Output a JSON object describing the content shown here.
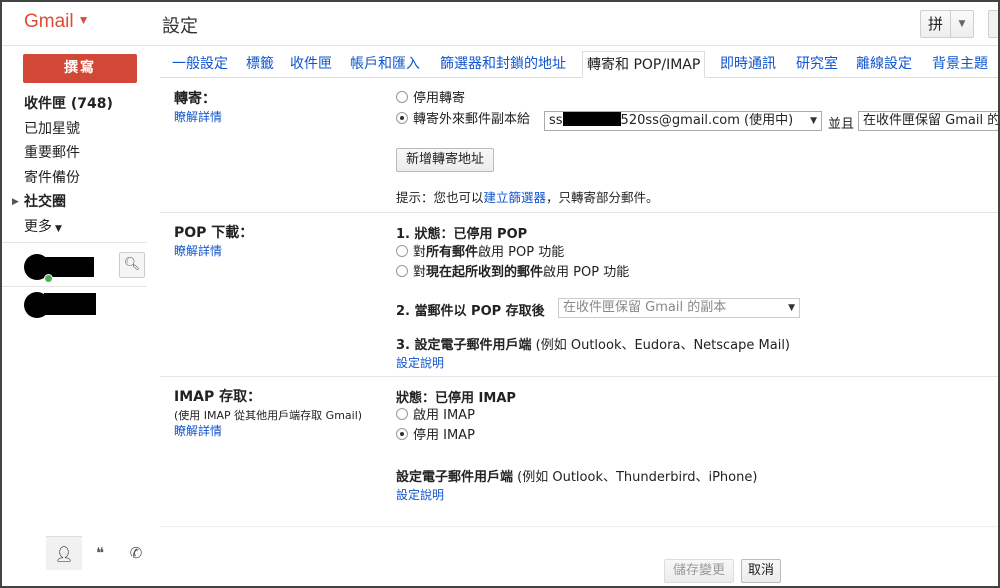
{
  "header": {
    "logo": "Gmail",
    "page_title": "設定",
    "ime_label": "拼"
  },
  "sidebar": {
    "compose": "撰寫",
    "nav": [
      {
        "label": "收件匣 (748)"
      },
      {
        "label": "已加星號"
      },
      {
        "label": "重要郵件"
      },
      {
        "label": "寄件備份"
      },
      {
        "label": "社交圈"
      },
      {
        "label": "更多"
      }
    ]
  },
  "tabs": [
    {
      "label": "一般設定"
    },
    {
      "label": "標籤"
    },
    {
      "label": "收件匣"
    },
    {
      "label": "帳戶和匯入"
    },
    {
      "label": "篩選器和封鎖的地址"
    },
    {
      "label": "轉寄和 POP/IMAP"
    },
    {
      "label": "即時通訊"
    },
    {
      "label": "研究室"
    },
    {
      "label": "離線設定"
    },
    {
      "label": "背景主題"
    }
  ],
  "forwarding": {
    "label": "轉寄：",
    "learn_more": "瞭解詳情",
    "disable": "停用轉寄",
    "forward_to": "轉寄外來郵件副本給",
    "address_prefix": "ss",
    "address_suffix": "520ss@gmail.com (使用中)",
    "and": "並且",
    "keep_option": "在收件匣保留 Gmail 的",
    "add_address": "新增轉寄地址",
    "tip_prefix": "提示：您也可以",
    "tip_link": "建立篩選器",
    "tip_suffix": "，只轉寄部分郵件。"
  },
  "pop": {
    "label": "POP 下載：",
    "learn_more": "瞭解詳情",
    "status_prefix": "1. 狀態：",
    "status_value": "已停用 POP",
    "opt_all_prefix": "對",
    "opt_all_bold": "所有郵件",
    "opt_all_suffix": "啟用 POP 功能",
    "opt_now_prefix": "對",
    "opt_now_bold": "現在起所收到的郵件",
    "opt_now_suffix": "啟用 POP 功能",
    "when_accessed": "2. 當郵件以 POP 存取後",
    "when_select": "在收件匣保留 Gmail 的副本",
    "configure_prefix": "3. 設定電子郵件用戶端",
    "configure_suffix": " (例如 Outlook、Eudora、Netscape Mail)",
    "config_link": "設定說明"
  },
  "imap": {
    "label": "IMAP 存取：",
    "sub": "(使用 IMAP 從其他用戶端存取 Gmail)",
    "learn_more": "瞭解詳情",
    "status_prefix": "狀態：",
    "status_value": "已停用 IMAP",
    "enable": "啟用 IMAP",
    "disable": "停用 IMAP",
    "configure_prefix": "設定電子郵件用戶端",
    "configure_suffix": " (例如 Outlook、Thunderbird、iPhone)",
    "config_link": "設定說明"
  },
  "actions": {
    "save": "儲存變更",
    "cancel": "取消"
  },
  "icons": {
    "logo_caret": "chevron-down-icon",
    "search": "search-icon",
    "person": "person-icon",
    "hangouts": "hangouts-icon",
    "phone": "phone-icon"
  },
  "colors": {
    "brand": "#dd4b39",
    "compose": "#d14836",
    "link": "#1155cc",
    "online": "#4caf50"
  }
}
